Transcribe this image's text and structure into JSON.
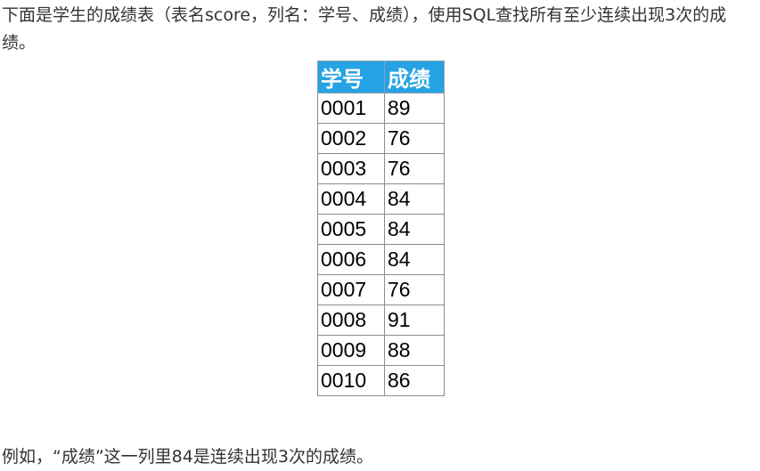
{
  "intro_text": "下面是学生的成绩表（表名score，列名：学号、成绩），使用SQL查找所有至少连续出现3次的成绩。",
  "table": {
    "headers": [
      "学号",
      "成绩"
    ],
    "rows": [
      [
        "0001",
        "89"
      ],
      [
        "0002",
        "76"
      ],
      [
        "0003",
        "76"
      ],
      [
        "0004",
        "84"
      ],
      [
        "0005",
        "84"
      ],
      [
        "0006",
        "84"
      ],
      [
        "0007",
        "76"
      ],
      [
        "0008",
        "91"
      ],
      [
        "0009",
        "88"
      ],
      [
        "0010",
        "86"
      ]
    ]
  },
  "outro_text": "例如，“成绩”这一列里84是连续出现3次的成绩。"
}
